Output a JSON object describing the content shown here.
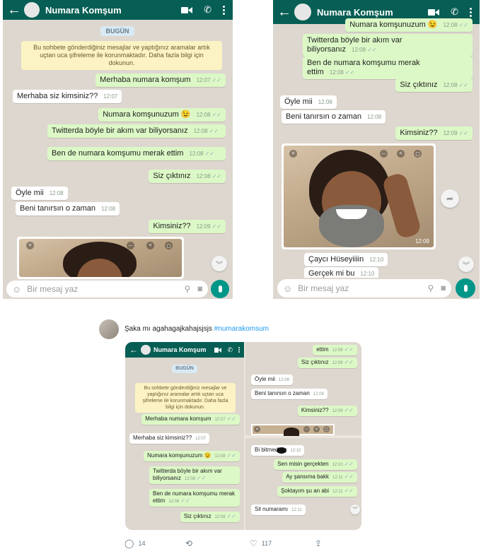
{
  "chat": {
    "contact_name": "Numara Komşum",
    "date_label": "BUGÜN",
    "encryption_notice": "Bu sohbete gönderdiğiniz mesajlar ve yaptığınız aramalar artık uçtan uca şifreleme ile korunmaktadır. Daha fazla bilgi için dokunun.",
    "input_placeholder": "Bir mesaj yaz"
  },
  "screenshot1": {
    "messages": [
      {
        "dir": "out",
        "text": "Merhaba numara komşum",
        "time": "12:07"
      },
      {
        "dir": "in",
        "text": "Merhaba siz kimsiniz??",
        "time": "12:07"
      },
      {
        "dir": "out",
        "text": "Numara komşunuzum 😉",
        "time": "12:08"
      },
      {
        "dir": "out",
        "text": "Twitterda böyle bir akım var biliyorsanız",
        "time": "12:08"
      },
      {
        "dir": "out",
        "text": "Ben de numara komşumu merak ettim",
        "time": "12:08"
      },
      {
        "dir": "out",
        "text": "Siz çıktınız",
        "time": "12:08"
      },
      {
        "dir": "in",
        "text": "Öyle mii",
        "time": "12:08"
      },
      {
        "dir": "in",
        "text": "Beni tanırsın o zaman",
        "time": "12:08"
      },
      {
        "dir": "out",
        "text": "Kimsiniz??",
        "time": "12:09"
      }
    ]
  },
  "screenshot2": {
    "messages": [
      {
        "dir": "out",
        "text": "Numara komşunuzum 😉",
        "time": "12:08"
      },
      {
        "dir": "out",
        "text": "Twitterda böyle bir akım var biliyorsanız",
        "time": "12:08"
      },
      {
        "dir": "out",
        "text": "Ben de numara komşumu merak ettim",
        "time": "12:08"
      },
      {
        "dir": "out",
        "text": "Siz çıktınız",
        "time": "12:08"
      },
      {
        "dir": "in",
        "text": "Öyle mii",
        "time": "12:08"
      },
      {
        "dir": "in",
        "text": "Beni tanırsın o zaman",
        "time": "12:08"
      },
      {
        "dir": "out",
        "text": "Kimsiniz??",
        "time": "12:09"
      },
      {
        "dir": "in",
        "text": "Çaycı Hüseyiiiin",
        "time": "12:10"
      },
      {
        "dir": "in",
        "text": "Gerçek mi bu",
        "time": "12:10"
      }
    ],
    "photo_time": "12:09"
  },
  "screenshot3": {
    "left": [
      {
        "dir": "out",
        "text": "Merhaba numara komşum",
        "time": "12:07"
      },
      {
        "dir": "in",
        "text": "Merhaba siz kimsiniz??",
        "time": "12:07"
      },
      {
        "dir": "out",
        "text": "Numara komşunuzum 😉",
        "time": "12:08"
      },
      {
        "dir": "out",
        "text": "Twitterda böyle bir akım var biliyorsanız",
        "time": "12:08"
      },
      {
        "dir": "out",
        "text": "Ben de numara komşumu merak ettim",
        "time": "12:08"
      },
      {
        "dir": "out",
        "text": "Siz çıktınız",
        "time": "12:08"
      }
    ],
    "right_top": [
      {
        "dir": "out",
        "text": "ettim",
        "time": "12:08"
      },
      {
        "dir": "out",
        "text": "Siz çıktınız",
        "time": "12:08"
      },
      {
        "dir": "in",
        "text": "Öyle mii",
        "time": "12:08"
      },
      {
        "dir": "in",
        "text": "Beni tanırsın o zaman",
        "time": "12:08"
      },
      {
        "dir": "out",
        "text": "Kimsiniz??",
        "time": "12:09"
      }
    ],
    "right_bottom": [
      {
        "dir": "in",
        "text": "Bi bitmediniz",
        "time": "12:10"
      },
      {
        "dir": "out",
        "text": "Sen misin gerçekten",
        "time": "12:10"
      },
      {
        "dir": "out",
        "text": "Ay şansıma bakk",
        "time": "12:11"
      },
      {
        "dir": "out",
        "text": "Şoktayım şu an abi",
        "time": "12:11"
      },
      {
        "dir": "in",
        "text": "Sil numaramı",
        "time": "12:11"
      }
    ]
  },
  "tweet": {
    "text": "Şaka mı agahagajkahajsjsjs",
    "hashtag": "#numarakomsum",
    "replies": "14",
    "retweets": "",
    "likes": "117"
  },
  "colors": {
    "header": "#075e54",
    "outgoing": "#dcf8c6",
    "incoming": "#ffffff",
    "background": "#ddd7cf",
    "mic": "#009688",
    "link": "#1d9bf0"
  }
}
